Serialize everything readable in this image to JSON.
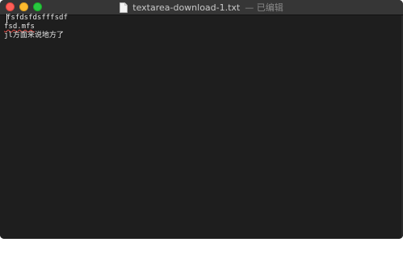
{
  "window": {
    "title": "textarea-download-1.txt",
    "status": "— 已编辑"
  },
  "icons": {
    "close": "close-button",
    "minimize": "minimize-button",
    "maximize": "zoom-button",
    "document": "document-icon"
  },
  "editor": {
    "lines": [
      "fsfdsfdsfffsdf",
      "fsd.mfs",
      "jl方面来说地方了"
    ]
  },
  "colors": {
    "background": "#1e1e1e",
    "titlebar": "#363636",
    "text": "#e6e6e6",
    "close": "#fe5f57",
    "minimize": "#febc2e",
    "maximize": "#28c840"
  }
}
